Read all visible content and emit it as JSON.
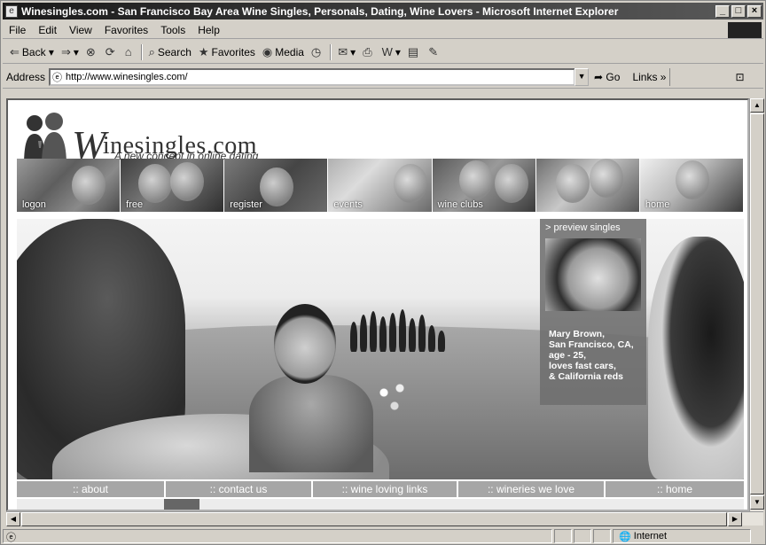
{
  "window": {
    "title": "Winesingles.com - San Francisco Bay Area Wine Singles, Personals, Dating, Wine Lovers - Microsoft Internet Explorer",
    "controls": {
      "minimize": "_",
      "maximize": "□",
      "close": "×"
    }
  },
  "menu": {
    "items": [
      "File",
      "Edit",
      "View",
      "Favorites",
      "Tools",
      "Help"
    ]
  },
  "toolbar": {
    "back_label": "Back",
    "search_label": "Search",
    "favorites_label": "Favorites",
    "media_label": "Media"
  },
  "address": {
    "label": "Address",
    "url": "http://www.winesingles.com/",
    "go_label": "Go",
    "links_label": "Links"
  },
  "status": {
    "left_text": "",
    "zone": "Internet"
  },
  "site": {
    "logo_w": "W",
    "logo_rest": "inesingles.com",
    "tagline": "A new concept in online dating",
    "nav": [
      "logon",
      "free",
      "register",
      "events",
      "wine clubs",
      "",
      "home"
    ],
    "preview": {
      "title": "> preview singles",
      "profile": "Mary Brown,\nSan Francisco, CA,\nage - 25,\nloves fast cars,\n& California reds"
    },
    "bottom_nav": [
      ":: about",
      ":: contact us",
      ":: wine loving links",
      ":: wineries we love",
      ":: home"
    ]
  },
  "icons": {
    "app": "ie-page-icon",
    "back": "back-arrow-icon",
    "forward": "forward-arrow-icon",
    "stop": "stop-icon",
    "refresh": "refresh-icon",
    "home": "home-icon",
    "search": "search-icon",
    "favorites": "favorites-icon",
    "media": "media-icon",
    "history": "history-icon",
    "mail": "mail-icon",
    "print": "print-icon",
    "edit": "word-edit-icon",
    "discuss": "discuss-icon",
    "messenger": "messenger-icon",
    "globe": "internet-zone-icon"
  }
}
